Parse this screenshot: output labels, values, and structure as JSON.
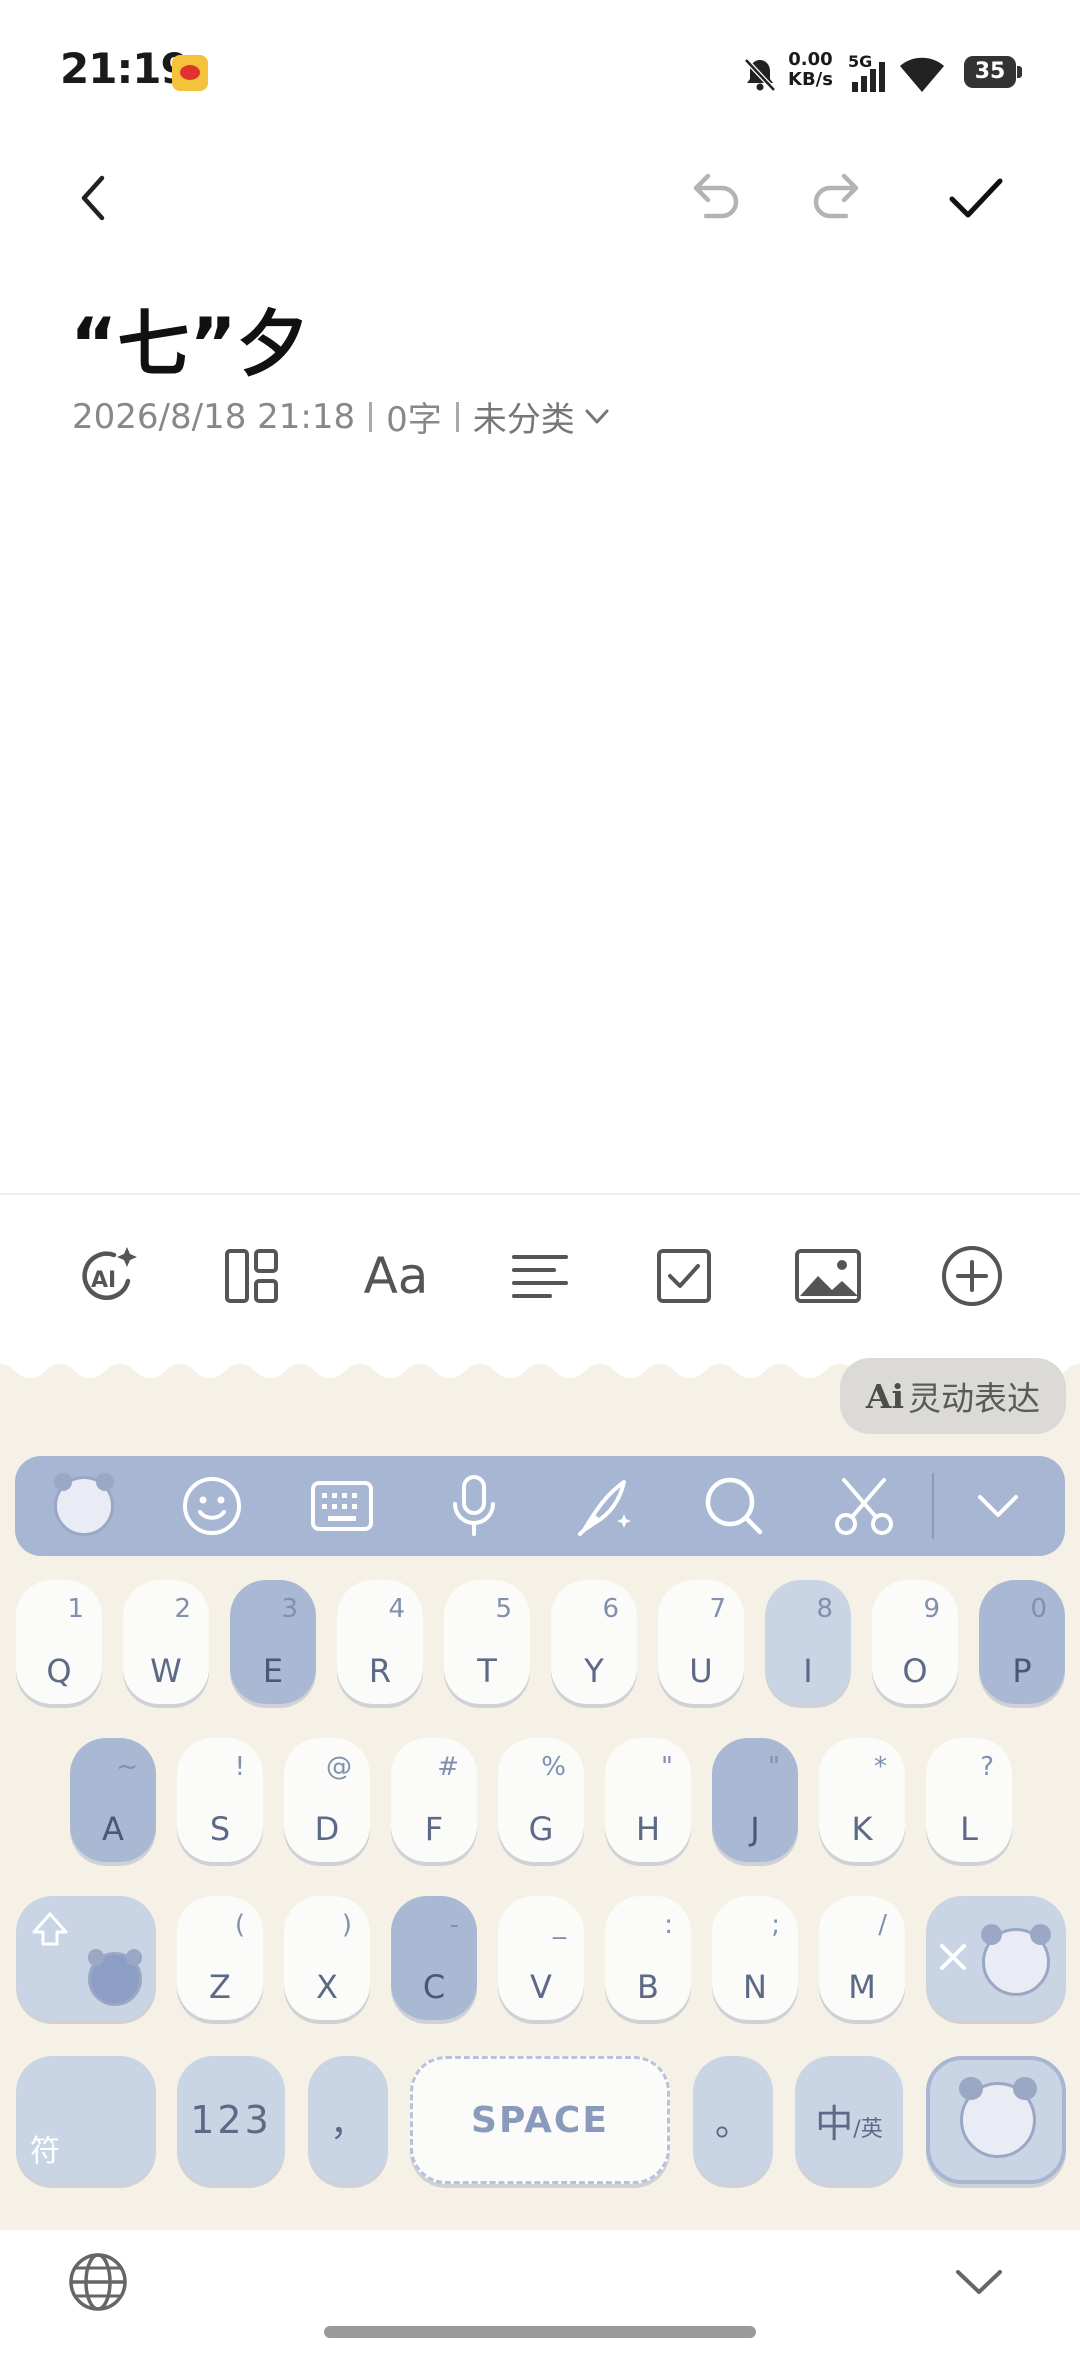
{
  "status_bar": {
    "time": "21:19",
    "net_speed_value": "0.00",
    "net_speed_unit": "KB/s",
    "network": "5G",
    "battery": "35"
  },
  "editor": {
    "title": "“七”夕",
    "date": "2026/8/18 21:18",
    "word_count": "0字",
    "category": "未分类"
  },
  "toolbar": {
    "ai_label": "AI",
    "font_label": "Aa"
  },
  "keyboard": {
    "ai_bubble_mark": "Ai",
    "ai_bubble_text": "灵动表达",
    "rows": [
      [
        {
          "letter": "Q",
          "sup": "1"
        },
        {
          "letter": "W",
          "sup": "2"
        },
        {
          "letter": "E",
          "sup": "3"
        },
        {
          "letter": "R",
          "sup": "4"
        },
        {
          "letter": "T",
          "sup": "5"
        },
        {
          "letter": "Y",
          "sup": "6"
        },
        {
          "letter": "U",
          "sup": "7"
        },
        {
          "letter": "I",
          "sup": "8"
        },
        {
          "letter": "O",
          "sup": "9"
        },
        {
          "letter": "P",
          "sup": "0"
        }
      ],
      [
        {
          "letter": "A",
          "sup": "~"
        },
        {
          "letter": "S",
          "sup": "!"
        },
        {
          "letter": "D",
          "sup": "@"
        },
        {
          "letter": "F",
          "sup": "#"
        },
        {
          "letter": "G",
          "sup": "%"
        },
        {
          "letter": "H",
          "sup": "\""
        },
        {
          "letter": "J",
          "sup": "\""
        },
        {
          "letter": "K",
          "sup": "*"
        },
        {
          "letter": "L",
          "sup": "?"
        }
      ],
      [
        {
          "letter": "Z",
          "sup": "("
        },
        {
          "letter": "X",
          "sup": ")"
        },
        {
          "letter": "C",
          "sup": "-"
        },
        {
          "letter": "V",
          "sup": "_"
        },
        {
          "letter": "B",
          "sup": ":"
        },
        {
          "letter": "N",
          "sup": ";"
        },
        {
          "letter": "M",
          "sup": "/"
        }
      ]
    ],
    "symbols_key": "符",
    "num_key": "123",
    "comma_key": "，",
    "space_key": "SPACE",
    "period_key": "。",
    "lang_key_main": "中",
    "lang_key_sub": "/英"
  }
}
